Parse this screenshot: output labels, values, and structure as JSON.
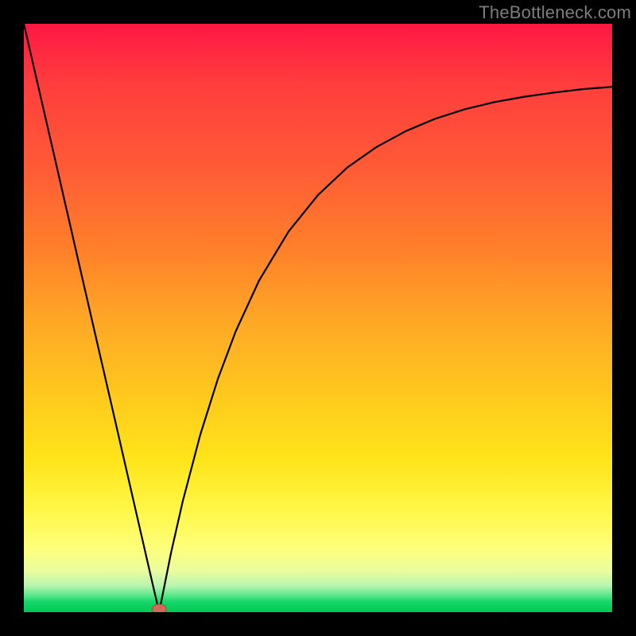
{
  "watermark": {
    "text": "TheBottleneck.com"
  },
  "colors": {
    "frame_bg": "#000000",
    "curve_stroke": "#000000",
    "marker_fill": "#d26a5c",
    "marker_stroke": "#a64b3f",
    "gradient_stops": [
      "#ff1744",
      "#ff7f2a",
      "#ffe41a",
      "#00c853"
    ]
  },
  "chart_data": {
    "type": "line",
    "title": "",
    "xlabel": "",
    "ylabel": "",
    "xlim": [
      0,
      100
    ],
    "ylim": [
      0,
      100
    ],
    "grid": false,
    "legend": false,
    "marker": {
      "x": 23,
      "y": 0,
      "shape": "ellipse"
    },
    "series": [
      {
        "name": "left-branch",
        "x": [
          0,
          5,
          10,
          15,
          20,
          22,
          23
        ],
        "values": [
          100,
          78.3,
          56.5,
          34.8,
          13.0,
          4.3,
          0
        ]
      },
      {
        "name": "right-branch",
        "x": [
          23,
          25,
          27,
          30,
          33,
          36,
          40,
          45,
          50,
          55,
          60,
          65,
          70,
          75,
          80,
          85,
          90,
          95,
          100
        ],
        "values": [
          0,
          10.0,
          18.8,
          30.2,
          39.7,
          47.7,
          56.4,
          64.7,
          70.9,
          75.6,
          79.1,
          81.8,
          83.9,
          85.5,
          86.7,
          87.6,
          88.3,
          88.9,
          89.3
        ]
      }
    ]
  }
}
